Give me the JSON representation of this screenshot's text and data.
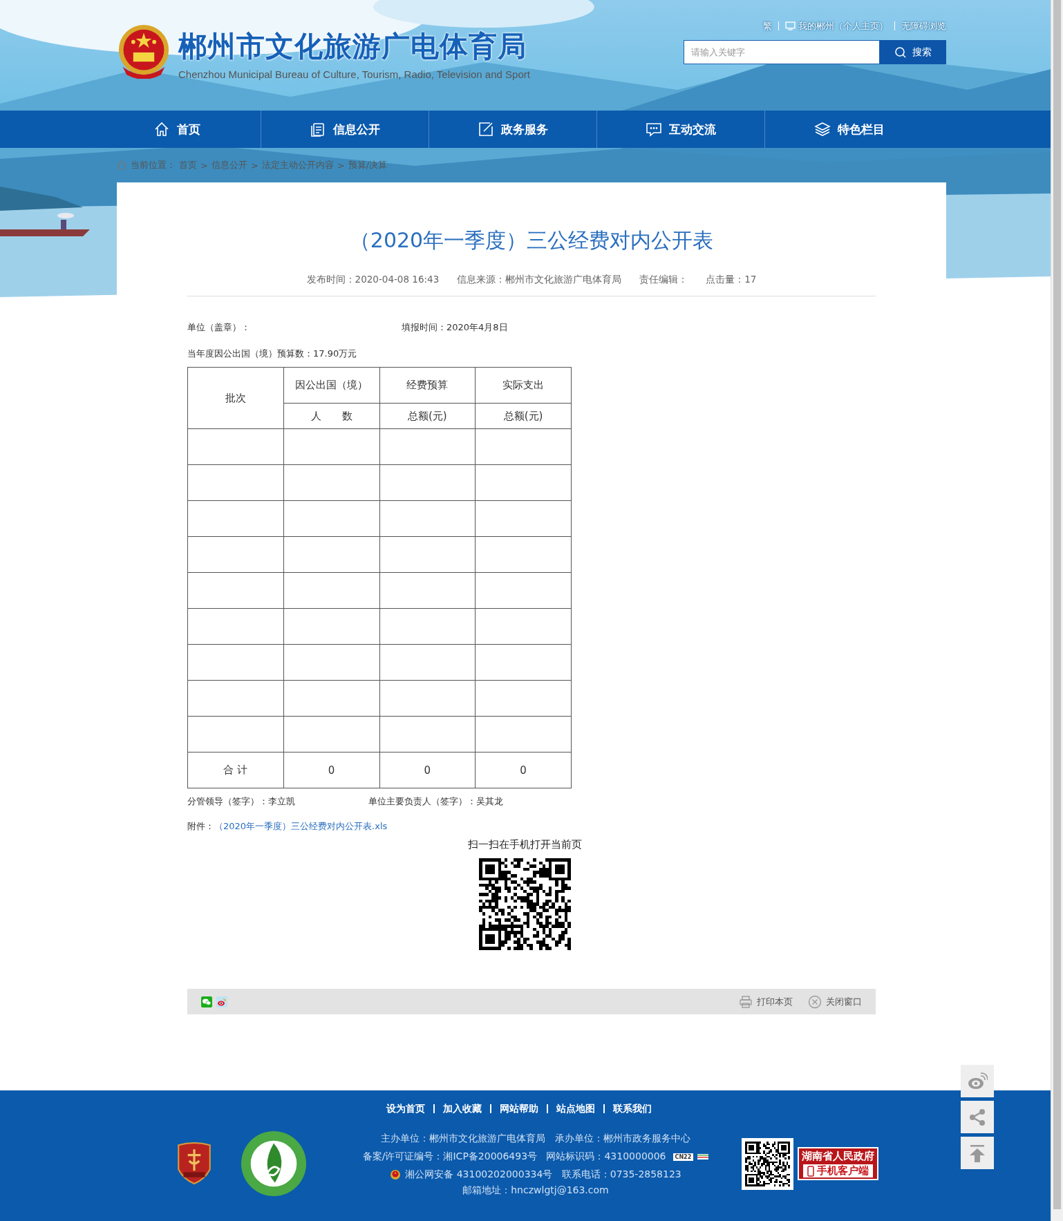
{
  "header": {
    "title": "郴州市文化旅游广电体育局",
    "subtitle": "Chenzhou Municipal Bureau of Culture, Tourism, Radio, Television and Sport",
    "top_links": [
      "繁",
      "我的郴州（个人主页）",
      "无障碍浏览"
    ],
    "search": {
      "placeholder": "请输入关键字",
      "button": "搜索"
    }
  },
  "nav": [
    {
      "label": "首页"
    },
    {
      "label": "信息公开"
    },
    {
      "label": "政务服务"
    },
    {
      "label": "互动交流"
    },
    {
      "label": "特色栏目"
    }
  ],
  "breadcrumb": {
    "label": "当前位置：",
    "separator": ">",
    "items": [
      "首页",
      "信息公开",
      "法定主动公开内容",
      "预算/决算"
    ]
  },
  "article": {
    "title": "（2020年一季度）三公经费对内公开表",
    "meta": [
      "发布时间：2020-04-08 16:43",
      "信息来源：郴州市文化旅游广电体育局",
      "责任编辑：",
      "点击量：17"
    ],
    "unit": "单位（盖章）：",
    "report_time": "填报时间：2020年4月8日",
    "budget": "当年度因公出国（境）预算数：17.90万元",
    "table": {
      "batch_header": "批次",
      "header_row_1": [
        "因公出国（境）",
        "经费预算",
        "实际支出"
      ],
      "header_row_2": [
        "人　　数",
        "总额(元)",
        "总额(元)"
      ],
      "total": {
        "label": "合 计",
        "values": [
          "0",
          "0",
          "0"
        ]
      }
    },
    "signatures": [
      "分管领导（签字）：李立凯",
      "单位主要负责人（签字）：吴其龙"
    ],
    "attachment": {
      "label": "附件：",
      "link": "（2020年一季度）三公经费对内公开表.xls"
    },
    "qr_caption": "扫一扫在手机打开当前页"
  },
  "share_bar": {
    "actions": [
      "打印本页",
      "关闭窗口"
    ]
  },
  "footer": {
    "links": [
      "设为首页",
      "加入收藏",
      "网站帮助",
      "站点地图",
      "联系我们"
    ],
    "lines": [
      "主办单位：郴州市文化旅游广电体育局   承办单位：郴州市政务服务中心",
      "备案/许可证编号：湘ICP备20006493号   网站标识码：4310000006"
    ],
    "cn22": "CN22",
    "police": "湘公网安备 43100202000334号   联系电话：0735-2858123",
    "email": "邮箱地址：hnczwlgtj@163.com",
    "app_badge": [
      "湖南省人民政府",
      "手机客户端"
    ]
  }
}
